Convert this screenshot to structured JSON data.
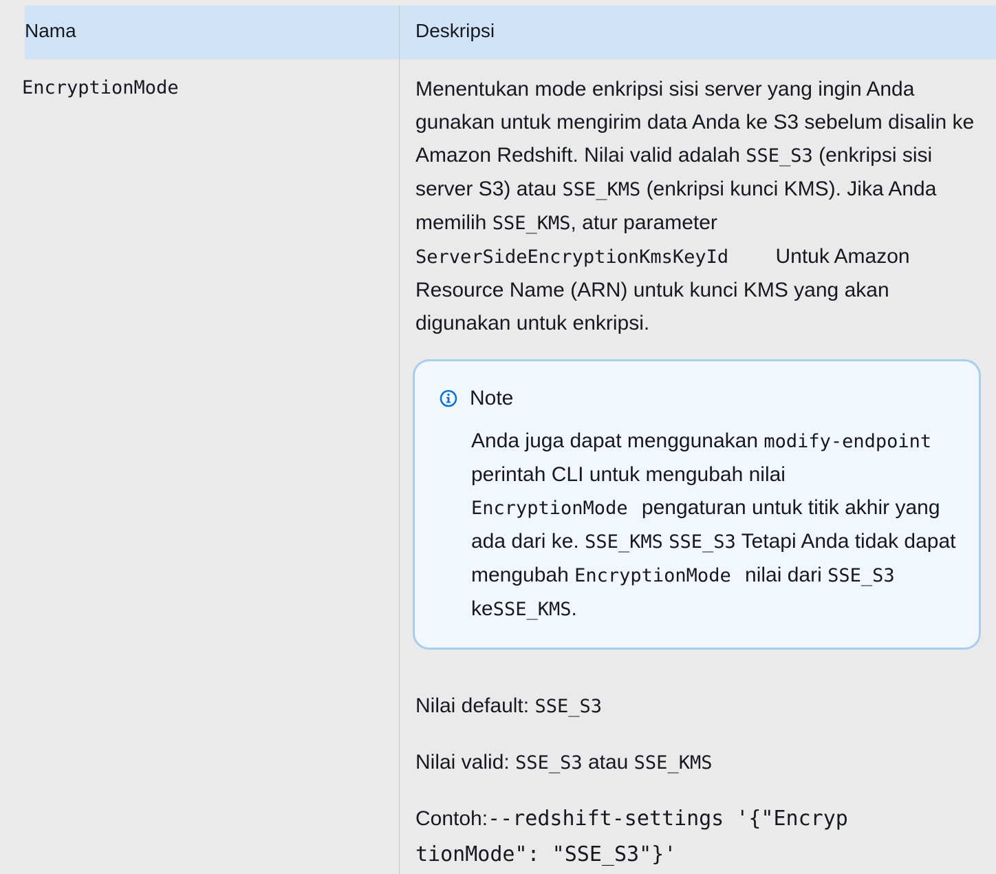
{
  "table": {
    "headers": {
      "name": "Nama",
      "description": "Deskripsi"
    },
    "row": {
      "name": "EncryptionMode",
      "description": {
        "part1": "Menentukan mode enkripsi sisi server yang ingin Anda gunakan untuk mengirim data Anda ke S3 sebelum disalin ke Amazon Redshift. Nilai valid adalah ",
        "code1": "SSE_S3",
        "part2": " (enkripsi sisi server S3) atau ",
        "code2": "SSE_KMS",
        "part3": " (enkripsi kunci KMS). Jika Anda memilih ",
        "code3": "SSE_KMS",
        "part4": ", atur parameter ",
        "code4": "ServerSideEncryptionKmsKeyId",
        "part5": " Untuk Amazon Resource Name (ARN) untuk kunci KMS yang akan digunakan untuk enkripsi."
      },
      "note": {
        "icon": "info-icon",
        "title": "Note",
        "part1": "Anda juga dapat menggunakan ",
        "code1": "modify-endpoint",
        "part2": " perintah CLI untuk mengubah nilai ",
        "code2": "EncryptionMode",
        "part3": " pengaturan untuk titik akhir yang ada dari ke. ",
        "code3": "SSE_KMS",
        "code4": "SSE_S3",
        "part4": " Tetapi Anda tidak dapat mengubah ",
        "code5": "EncryptionMode",
        "part5": " nilai dari ",
        "code6": "SSE_S3",
        "part6": " ke",
        "code7": "SSE_KMS",
        "part7": "."
      },
      "default_value": {
        "label": "Nilai default: ",
        "value": "SSE_S3"
      },
      "valid_values": {
        "label": "Nilai valid: ",
        "value1": "SSE_S3",
        "separator": " atau ",
        "value2": "SSE_KMS"
      },
      "example": {
        "label": "Contoh:",
        "code_line1": "--redshift-settings '{\"Encryp",
        "code_line2": "tionMode\": \"SSE_S3\"}'"
      }
    }
  },
  "colors": {
    "header_bg": "#d1e4f7",
    "page_bg": "#eaeaeb",
    "note_border": "#a8cdef",
    "note_bg": "#f1f7fd",
    "info_icon": "#0972d3"
  }
}
